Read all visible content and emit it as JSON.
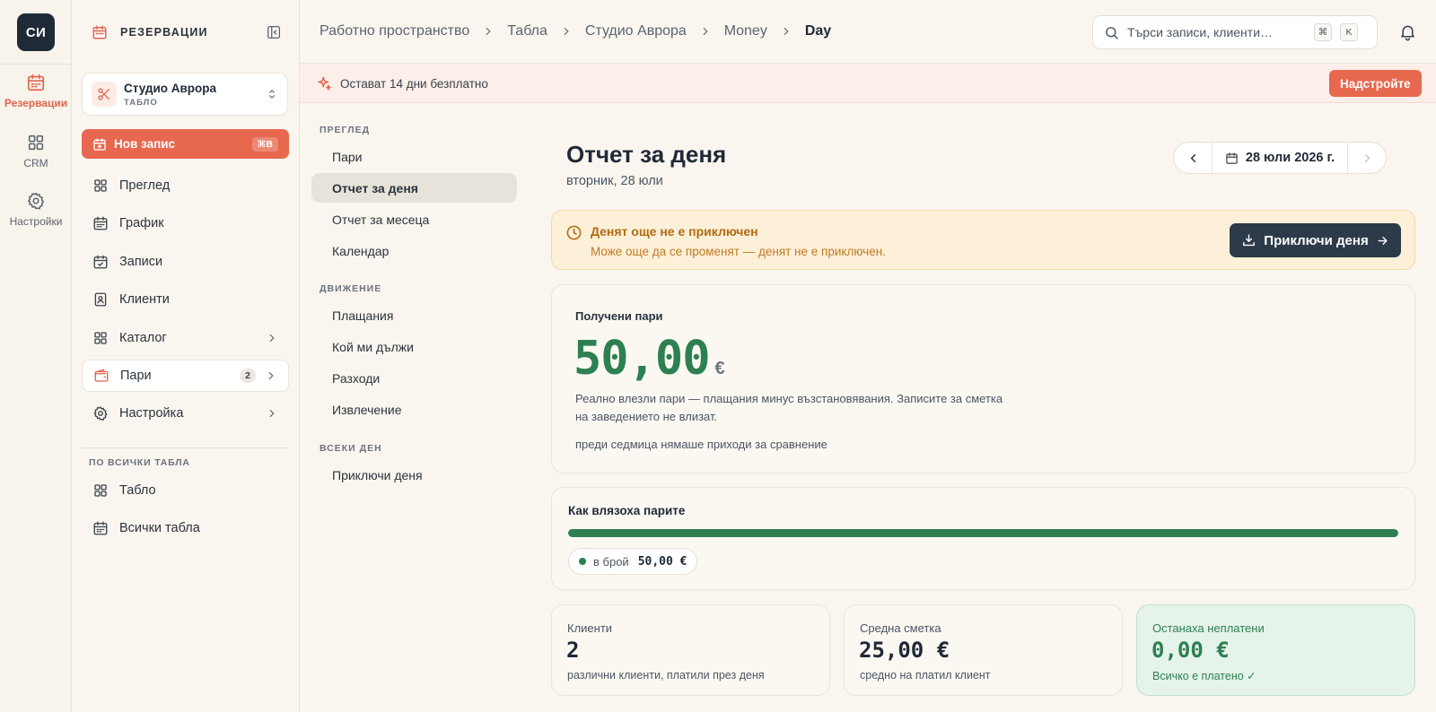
{
  "rail": {
    "logo": "СИ",
    "items": [
      {
        "label": "Резервации",
        "icon": "calendar-icon",
        "active": true
      },
      {
        "label": "CRM",
        "icon": "grid-icon"
      },
      {
        "label": "Настройки",
        "icon": "gear-icon"
      }
    ]
  },
  "sidebar": {
    "title": "РЕЗЕРВАЦИИ",
    "studio": {
      "name": "Студио Аврора",
      "sub": "ТАБЛО"
    },
    "new_button": {
      "label": "Нов запис",
      "shortcut": "⌘B"
    },
    "items": [
      {
        "label": "Преглед",
        "icon": "grid-icon"
      },
      {
        "label": "График",
        "icon": "calendar-icon"
      },
      {
        "label": "Записи",
        "icon": "calendar-check-icon"
      },
      {
        "label": "Клиенти",
        "icon": "contact-icon"
      },
      {
        "label": "Каталог",
        "icon": "grid-icon"
      },
      {
        "label": "Пари",
        "icon": "wallet-icon",
        "badge": "2",
        "active": true
      },
      {
        "label": "Настройка",
        "icon": "gear-icon"
      }
    ],
    "section_label": "ПО ВСИЧКИ ТАБЛА",
    "section_items": [
      {
        "label": "Табло",
        "icon": "grid-icon"
      },
      {
        "label": "Всички табла",
        "icon": "calendar-icon"
      }
    ]
  },
  "topbar": {
    "breadcrumbs": [
      "Работно пространство",
      "Табла",
      "Студио Аврора",
      "Money",
      "Day"
    ],
    "search_placeholder": "Търси записи, клиенти…",
    "search_keys": [
      "⌘",
      "K"
    ]
  },
  "trial": {
    "text": "Остават 14 дни безплатно",
    "upgrade": "Надстройте"
  },
  "subnav": {
    "sections": [
      {
        "label": "ПРЕГЛЕД",
        "items": [
          "Пари",
          "Отчет за деня",
          "Отчет за месеца",
          "Календар"
        ]
      },
      {
        "label": "ДВИЖЕНИЕ",
        "items": [
          "Плащания",
          "Кой ми дължи",
          "Разходи",
          "Извлечение"
        ]
      },
      {
        "label": "ВСЕКИ ДЕН",
        "items": [
          "Приключи деня"
        ]
      }
    ],
    "active": "Отчет за деня"
  },
  "report": {
    "title": "Отчет за деня",
    "subtitle": "вторник, 28 юли",
    "date": "28 юли 2026 г."
  },
  "alert": {
    "title": "Денят още не е приключен",
    "text": "Може още да се променят — денят не е приключен.",
    "button": "Приключи деня"
  },
  "received": {
    "label": "Получени пари",
    "amount": "50,00",
    "currency": "€",
    "desc": "Реално влезли пари — плащания минус възстановявания. Записите за сметка на заведението не влизат.",
    "compare": "преди седмица нямаше приходи за сравнение"
  },
  "flow": {
    "label": "Как влязоха парите",
    "cash_share": 1.0,
    "chip_label": "в брой",
    "chip_value": "50,00 €"
  },
  "stats": [
    {
      "label": "Клиенти",
      "value": "2",
      "note": "различни клиенти, платили през деня"
    },
    {
      "label": "Средна сметка",
      "value": "25,00 €",
      "note": "средно на платил клиент"
    },
    {
      "label": "Останаха неплатени",
      "value": "0,00 €",
      "note": "Всичко е платено ✓"
    }
  ],
  "colors": {
    "accent": "#e7684f",
    "success": "#2c8052",
    "dark": "#2c3a4a",
    "warning": "#b36a12"
  }
}
